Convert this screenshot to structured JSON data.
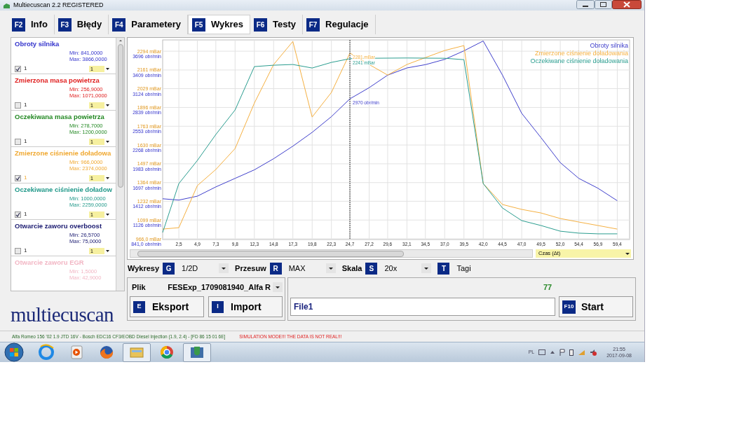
{
  "window": {
    "title": "Multiecuscan 2.2 REGISTERED"
  },
  "tabs": [
    {
      "key": "F2",
      "label": "Info",
      "selected": false
    },
    {
      "key": "F3",
      "label": "Błędy",
      "selected": false
    },
    {
      "key": "F4",
      "label": "Parametery",
      "selected": false
    },
    {
      "key": "F5",
      "label": "Wykres",
      "selected": true
    },
    {
      "key": "F6",
      "label": "Testy",
      "selected": false
    },
    {
      "key": "F7",
      "label": "Regulacje",
      "selected": false
    }
  ],
  "parameters": [
    {
      "name": "Obroty silnika",
      "color": "#3333cc",
      "min": "Min: 841,0000",
      "max": "Max: 3866,0000",
      "checked": true,
      "index": "1",
      "scale": "1"
    },
    {
      "name": "Zmierzona masa powietrza",
      "color": "#e02020",
      "min": "Min: 256,9000",
      "max": "Max: 1071,0000",
      "checked": false,
      "index": "1",
      "scale": "1"
    },
    {
      "name": "Oczekiwana masa powietrza",
      "color": "#228822",
      "min": "Min: 278,7000",
      "max": "Max: 1200,0000",
      "checked": false,
      "index": "1",
      "scale": "1"
    },
    {
      "name": "Zmierzone ciśnienie doładowa",
      "color": "#f0a830",
      "min": "Min: 966,0000",
      "max": "Max: 2374,0000",
      "checked": true,
      "index": "1",
      "scale": "1"
    },
    {
      "name": "Oczekiwane ciśnienie doładow",
      "color": "#22998a",
      "min": "Min: 1000,0000",
      "max": "Max: 2259,0000",
      "checked": true,
      "index": "1",
      "scale": "1"
    },
    {
      "name": "Otwarcie zaworu overboost",
      "color": "#1a1a70",
      "min": "Min: 26,5700",
      "max": "Max: 75,0000",
      "checked": false,
      "index": "1",
      "scale": "1"
    },
    {
      "name": "Otwarcie zaworu EGR",
      "color": "#f2b6c4",
      "min": "Min: 1,5000",
      "max": "Max: 42,9000"
    }
  ],
  "logo": "multiecuscan",
  "chart": {
    "chart_data": {
      "type": "line",
      "x": [
        0.4,
        2.5,
        4.9,
        7.3,
        9.8,
        12.3,
        14.8,
        17.3,
        19.8,
        22.3,
        24.7,
        27.2,
        29.6,
        32.1,
        34.5,
        37.0,
        39.5,
        42.0,
        44.5,
        47.0,
        49.5,
        52.0,
        54.4,
        56.9,
        59.4
      ],
      "xticks": [
        {
          "value": 2.5,
          "label": "2,5"
        },
        {
          "value": 4.9,
          "label": "4,9"
        },
        {
          "value": 7.3,
          "label": "7,3"
        },
        {
          "value": 9.8,
          "label": "9,8"
        },
        {
          "value": 12.3,
          "label": "12,3"
        },
        {
          "value": 14.8,
          "label": "14,8"
        },
        {
          "value": 17.3,
          "label": "17,3"
        },
        {
          "value": 19.8,
          "label": "19,8"
        },
        {
          "value": 22.3,
          "label": "22,3"
        },
        {
          "value": 24.7,
          "label": "24,7"
        },
        {
          "value": 27.2,
          "label": "27,2"
        },
        {
          "value": 29.6,
          "label": "29,6"
        },
        {
          "value": 32.1,
          "label": "32,1"
        },
        {
          "value": 34.5,
          "label": "34,5"
        },
        {
          "value": 37.0,
          "label": "37,0"
        },
        {
          "value": 39.5,
          "label": "39,5"
        },
        {
          "value": 42.0,
          "label": "42,0"
        },
        {
          "value": 44.5,
          "label": "44,5"
        },
        {
          "value": 47.0,
          "label": "47,0"
        },
        {
          "value": 49.5,
          "label": "49,5"
        },
        {
          "value": 52.0,
          "label": "52,0"
        },
        {
          "value": 54.4,
          "label": "54,4"
        },
        {
          "value": 56.9,
          "label": "56,9"
        },
        {
          "value": 59.4,
          "label": "59,4"
        }
      ],
      "xlim": [
        0.4,
        61.0
      ],
      "ylim": [
        966,
        2374
      ],
      "yticks": [
        {
          "value": 2294,
          "label": "2294 mBar"
        },
        {
          "value": 2161,
          "label": "2161 mBar"
        },
        {
          "value": 2029,
          "label": "2029 mBar"
        },
        {
          "value": 1896,
          "label": "1896 mBar"
        },
        {
          "value": 1763,
          "label": "1763 mBar"
        },
        {
          "value": 1630,
          "label": "1630 mBar"
        },
        {
          "value": 1497,
          "label": "1497 mBar"
        },
        {
          "value": 1364,
          "label": "1364 mBar"
        },
        {
          "value": 1232,
          "label": "1232 mBar"
        },
        {
          "value": 1099,
          "label": "1099 mBar"
        },
        {
          "value": 966,
          "label": "966,0 mBar"
        }
      ],
      "series": [
        {
          "name": "Obroty silnika",
          "color": "#4040cc",
          "axis": "y2",
          "values": [
            1450,
            1430,
            1490,
            1630,
            1760,
            1890,
            2060,
            2250,
            2460,
            2700,
            2970,
            3140,
            3330,
            3440,
            3490,
            3570,
            3700,
            3850,
            3330,
            2750,
            2380,
            2000,
            1760,
            1610,
            1420
          ]
        },
        {
          "name": "Zmierzone ciśnienie doładowania",
          "color": "#f5b041",
          "values": [
            1035,
            1045,
            1343,
            1457,
            1605,
            1927,
            2200,
            2363,
            1828,
            2002,
            2281,
            2200,
            2125,
            2200,
            2249,
            2299,
            2334,
            1357,
            1209,
            1174,
            1149,
            1110,
            1085,
            1060,
            1035
          ]
        },
        {
          "name": "Oczekiwane ciśnienie doładowania",
          "color": "#2a9d8f",
          "values": [
            1011,
            1357,
            1521,
            1704,
            1878,
            2185,
            2195,
            2200,
            2175,
            2215,
            2241,
            2244,
            2245,
            2246,
            2245,
            2244,
            2234,
            1357,
            1184,
            1095,
            1060,
            1020,
            1006,
            1001,
            1001
          ]
        }
      ],
      "y2lim": [
        841,
        3866
      ],
      "y2ticks": [
        {
          "value": 3696,
          "label": "3696 obr/min"
        },
        {
          "value": 3409,
          "label": "3409 obr/min"
        },
        {
          "value": 3124,
          "label": "3124 obr/min"
        },
        {
          "value": 2839,
          "label": "2839 obr/min"
        },
        {
          "value": 2553,
          "label": "2553 obr/min"
        },
        {
          "value": 2268,
          "label": "2268 obr/min"
        },
        {
          "value": 1983,
          "label": "1983 obr/min"
        },
        {
          "value": 1697,
          "label": "1697 obr/min"
        },
        {
          "value": 1412,
          "label": "1412 obr/min"
        },
        {
          "value": 1126,
          "label": "1126 obr/min"
        },
        {
          "value": 841,
          "label": "841,0 obr/min"
        }
      ],
      "grid": true,
      "ref_lines": [
        {
          "axis": "x",
          "value": 24.7
        }
      ],
      "annotations": [
        {
          "x": 24.7,
          "y": 2281,
          "text": "2281 mBar"
        },
        {
          "x": 24.7,
          "y": 2241,
          "text": "2241 mBar"
        },
        "2970 obr/min"
      ]
    },
    "time_axis": "Czas (Δt)"
  },
  "controls": [
    {
      "label": "Wykresy",
      "key": "G",
      "value": "1/2D",
      "dropdown": true
    },
    {
      "label": "Przesuw",
      "key": "R",
      "value": "MAX",
      "dropdown": true
    },
    {
      "label": "Skala",
      "key": "S",
      "value": "20x",
      "dropdown": true
    },
    {
      "key": "T",
      "value": "Tagi",
      "dropdown": false
    }
  ],
  "file_panel": {
    "label": "Plik",
    "value": "FESExp_1709081940_Alfa R",
    "buttons": [
      {
        "key": "E",
        "label": "Eksport"
      },
      {
        "key": "I",
        "label": "Import"
      }
    ]
  },
  "run_panel": {
    "count": "77",
    "file_value": "File1",
    "start": {
      "key": "F10",
      "label": "Start"
    }
  },
  "status_bar": {
    "ecu": "Alfa Romeo 156 '02 1.9 JTD 16V - Bosch EDC16 CF3/EOBD Diesel Injection (1.9, 2.4) - [FD 86 15 01 6E]",
    "warning": "SIMULATION MODE!!! THE DATA IS NOT REAL!!!"
  },
  "taskbar": {
    "apps": [
      {
        "kind": "globe",
        "open": false
      },
      {
        "kind": "play",
        "open": false
      },
      {
        "kind": "fox",
        "open": false
      },
      {
        "kind": "folder",
        "open": true
      },
      {
        "kind": "ring",
        "open": false
      },
      {
        "kind": "shield",
        "open": true
      }
    ],
    "language": "PL",
    "time": "21:55",
    "date": "2017-09-08"
  }
}
